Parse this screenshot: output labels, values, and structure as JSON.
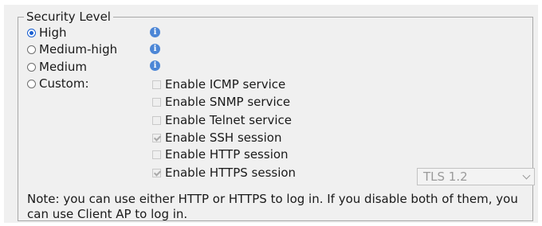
{
  "security_level": {
    "legend": "Security Level",
    "options": [
      {
        "label": "High",
        "selected": true,
        "has_info": true
      },
      {
        "label": "Medium-high",
        "selected": false,
        "has_info": true
      },
      {
        "label": "Medium",
        "selected": false,
        "has_info": true
      },
      {
        "label": "Custom:",
        "selected": false,
        "has_info": false
      }
    ],
    "custom_items": [
      {
        "label": "Enable ICMP service",
        "checked": false
      },
      {
        "label": "Enable SNMP service",
        "checked": false
      },
      {
        "label": "Enable Telnet service",
        "checked": false
      },
      {
        "label": "Enable SSH session",
        "checked": true
      },
      {
        "label": "Enable HTTP session",
        "checked": false
      },
      {
        "label": "Enable HTTPS session",
        "checked": true
      }
    ],
    "tls_select": {
      "value": "TLS 1.2"
    },
    "note": "Note: you can use either HTTP or HTTPS to log in. If you disable both of them, you can use Client AP to log in."
  },
  "info_icon_name": "info-icon",
  "accent_color": "#1a5fd1"
}
